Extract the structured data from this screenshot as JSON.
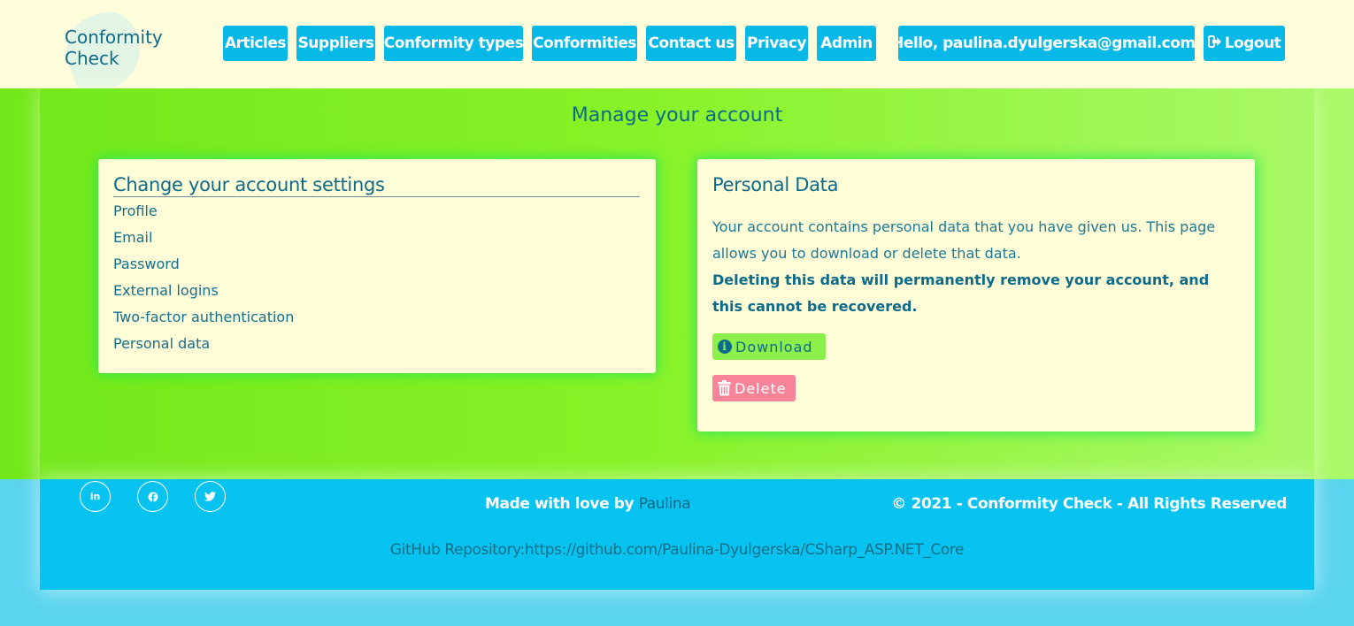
{
  "header": {
    "logo_text": "Conformity\nCheck",
    "nav": {
      "articles": "Articles",
      "suppliers": "Suppliers",
      "conformity_types": "Conformity types",
      "conformities": "Conformities",
      "contact": "Contact us",
      "privacy": "Privacy",
      "admin": "Admin",
      "greeting": "Hello, paulina.dyulgerska@gmail.com!",
      "logout": "Logout"
    }
  },
  "main": {
    "heading": "Manage your account",
    "settings": {
      "title": "Change your account settings",
      "items": [
        "Profile",
        "Email",
        "Password",
        "External logins",
        "Two-factor authentication",
        "Personal data"
      ]
    },
    "personal_data": {
      "title": "Personal Data",
      "description": "Your account contains personal data that you have given us. This page allows you to download or delete that data.",
      "warning": "Deleting this data will permanently remove your account, and this cannot be recovered.",
      "download_label": "Download",
      "delete_label": "Delete"
    }
  },
  "footer": {
    "social": [
      "linkedin-icon",
      "facebook-icon",
      "twitter-icon"
    ],
    "made_with_prefix": "Made with love by ",
    "author": "Paulina",
    "copyright": "© 2021 - Conformity Check - All Rights Reserved",
    "github": "GitHub Repository:https://github.com/Paulina-Dyulgerska/CSharp_ASP.NET_Core"
  },
  "colors": {
    "header_bg": "#fffcdc",
    "nav_button": "#08b8e6",
    "main_green": "#86f225",
    "card_bg": "#fffcd8",
    "text_primary": "#0d6b8a",
    "download_button": "#8cef4a",
    "delete_button": "#f78499",
    "footer_bg": "#08c2ef"
  }
}
